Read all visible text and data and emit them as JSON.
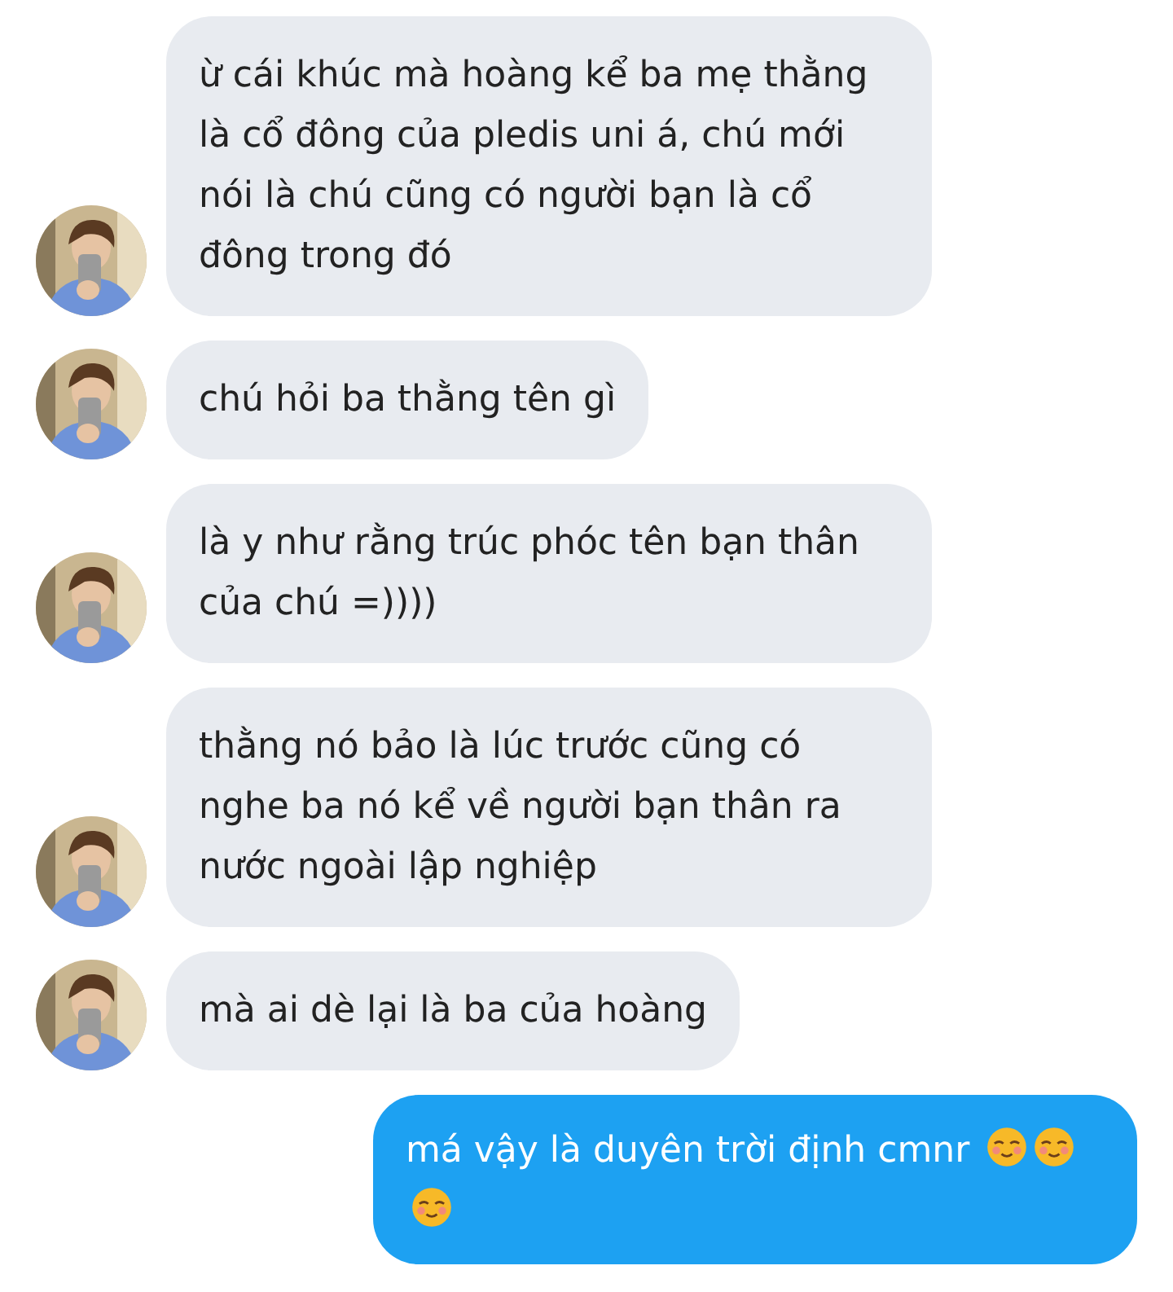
{
  "messages": [
    {
      "kind": "received",
      "text": "ừ cái khúc mà hoàng kể ba mẹ thằng là cổ đông của pledis uni á, chú mới nói là chú cũng có người bạn là cổ đông trong đó"
    },
    {
      "kind": "received",
      "text": "chú hỏi ba thằng tên gì"
    },
    {
      "kind": "received",
      "text": "là y như rằng trúc phóc tên bạn thân của chú =))))"
    },
    {
      "kind": "received",
      "text": "thằng nó bảo là lúc trước cũng có nghe ba nó kể về người bạn thân ra nước ngoài lập nghiệp"
    },
    {
      "kind": "received",
      "text": "mà ai dè lại là ba của hoàng"
    },
    {
      "kind": "sent",
      "text": "má vậy là duyên trời định cmnr",
      "emoji": [
        {
          "kind": "smile"
        },
        {
          "kind": "smile"
        },
        {
          "kind": "smile"
        }
      ]
    }
  ]
}
